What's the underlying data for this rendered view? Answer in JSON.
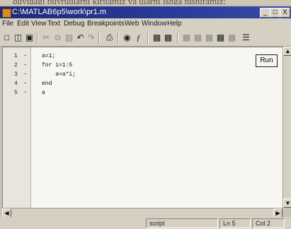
{
  "window": {
    "title": "C:\\MATLAB6p5\\work\\pr1.m",
    "min_label": "_",
    "max_label": "□",
    "close_label": "X"
  },
  "menu": [
    "File",
    "Edit",
    "View",
    "Text",
    "Debug",
    "Breakpoints",
    "Web",
    "Window",
    "Help"
  ],
  "editor": {
    "lines": [
      {
        "num": "1",
        "marker": "-",
        "code": "a=1;"
      },
      {
        "num": "2",
        "marker": "-",
        "code": "for i=1:5"
      },
      {
        "num": "3",
        "marker": "-",
        "code": "    a=a*i;"
      },
      {
        "num": "4",
        "marker": "-",
        "code": "end"
      },
      {
        "num": "5",
        "marker": "-",
        "code": "a"
      }
    ],
    "run_label": "Run"
  },
  "status": {
    "mode": "script",
    "line": "Ln 5",
    "col": "Col 2"
  }
}
